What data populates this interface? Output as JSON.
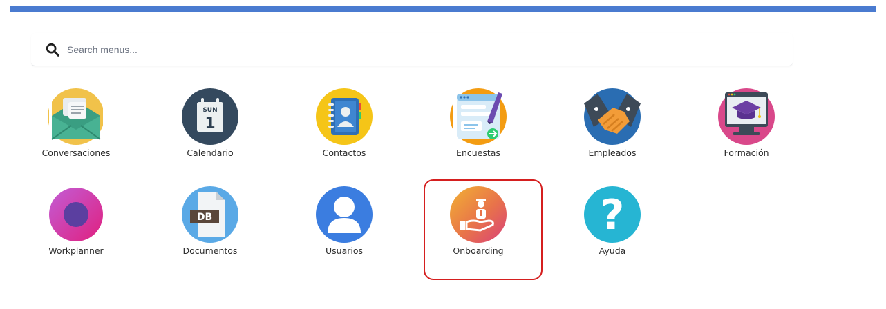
{
  "search": {
    "placeholder": "Search menus..."
  },
  "apps": [
    {
      "label": "Conversaciones",
      "icon": "envelope-chat-icon"
    },
    {
      "label": "Calendario",
      "icon": "calendar-icon",
      "badge_day": "SUN",
      "badge_date": "1"
    },
    {
      "label": "Contactos",
      "icon": "address-book-icon"
    },
    {
      "label": "Encuestas",
      "icon": "survey-pen-icon"
    },
    {
      "label": "Empleados",
      "icon": "handshake-icon"
    },
    {
      "label": "Formación",
      "icon": "graduation-cap-icon"
    },
    {
      "label": "Workplanner",
      "icon": "workplanner-circle-icon"
    },
    {
      "label": "Documentos",
      "icon": "document-db-icon",
      "badge": "DB"
    },
    {
      "label": "Usuarios",
      "icon": "user-icon"
    },
    {
      "label": "Onboarding",
      "icon": "onboarding-hand-icon"
    },
    {
      "label": "Ayuda",
      "icon": "question-mark-icon",
      "glyph": "?"
    }
  ],
  "colors": {
    "frame_border": "#4a7bd0",
    "highlight_border": "#d51f1f"
  }
}
